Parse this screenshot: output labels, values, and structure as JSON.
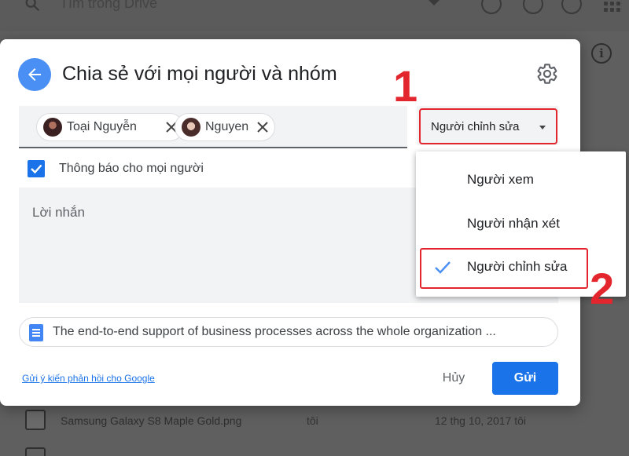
{
  "background": {
    "search_placeholder": "Tìm trong Drive",
    "file_row": {
      "name": "Samsung Galaxy S8 Maple Gold.png",
      "owner": "tôi",
      "date": "12 thg 10, 2017",
      "modifier": "tôi"
    }
  },
  "dialog": {
    "title": "Chia sẻ với mọi người và nhóm",
    "recipients": [
      {
        "name": "Toại Nguyễn"
      },
      {
        "name": "Nguyen"
      }
    ],
    "permission": {
      "selected": "Người chỉnh sửa"
    },
    "notify": {
      "label": "Thông báo cho mọi người",
      "checked": true
    },
    "message": {
      "placeholder": "Lời nhắn"
    },
    "document": {
      "title": "The end-to-end support of business processes across the whole organization ..."
    },
    "feedback_link": "Gửi ý kiến phản hồi cho Google",
    "cancel_label": "Hủy",
    "send_label": "Gửi"
  },
  "permission_menu": {
    "items": [
      {
        "label": "Người xem",
        "checked": false
      },
      {
        "label": "Người nhận xét",
        "checked": false
      },
      {
        "label": "Người chỉnh sửa",
        "checked": true
      }
    ]
  },
  "annotations": {
    "step1": "1",
    "step2": "2"
  },
  "colors": {
    "accent": "#1a73e8",
    "annotation": "#e3262d",
    "back_button": "#4a8ff4"
  }
}
